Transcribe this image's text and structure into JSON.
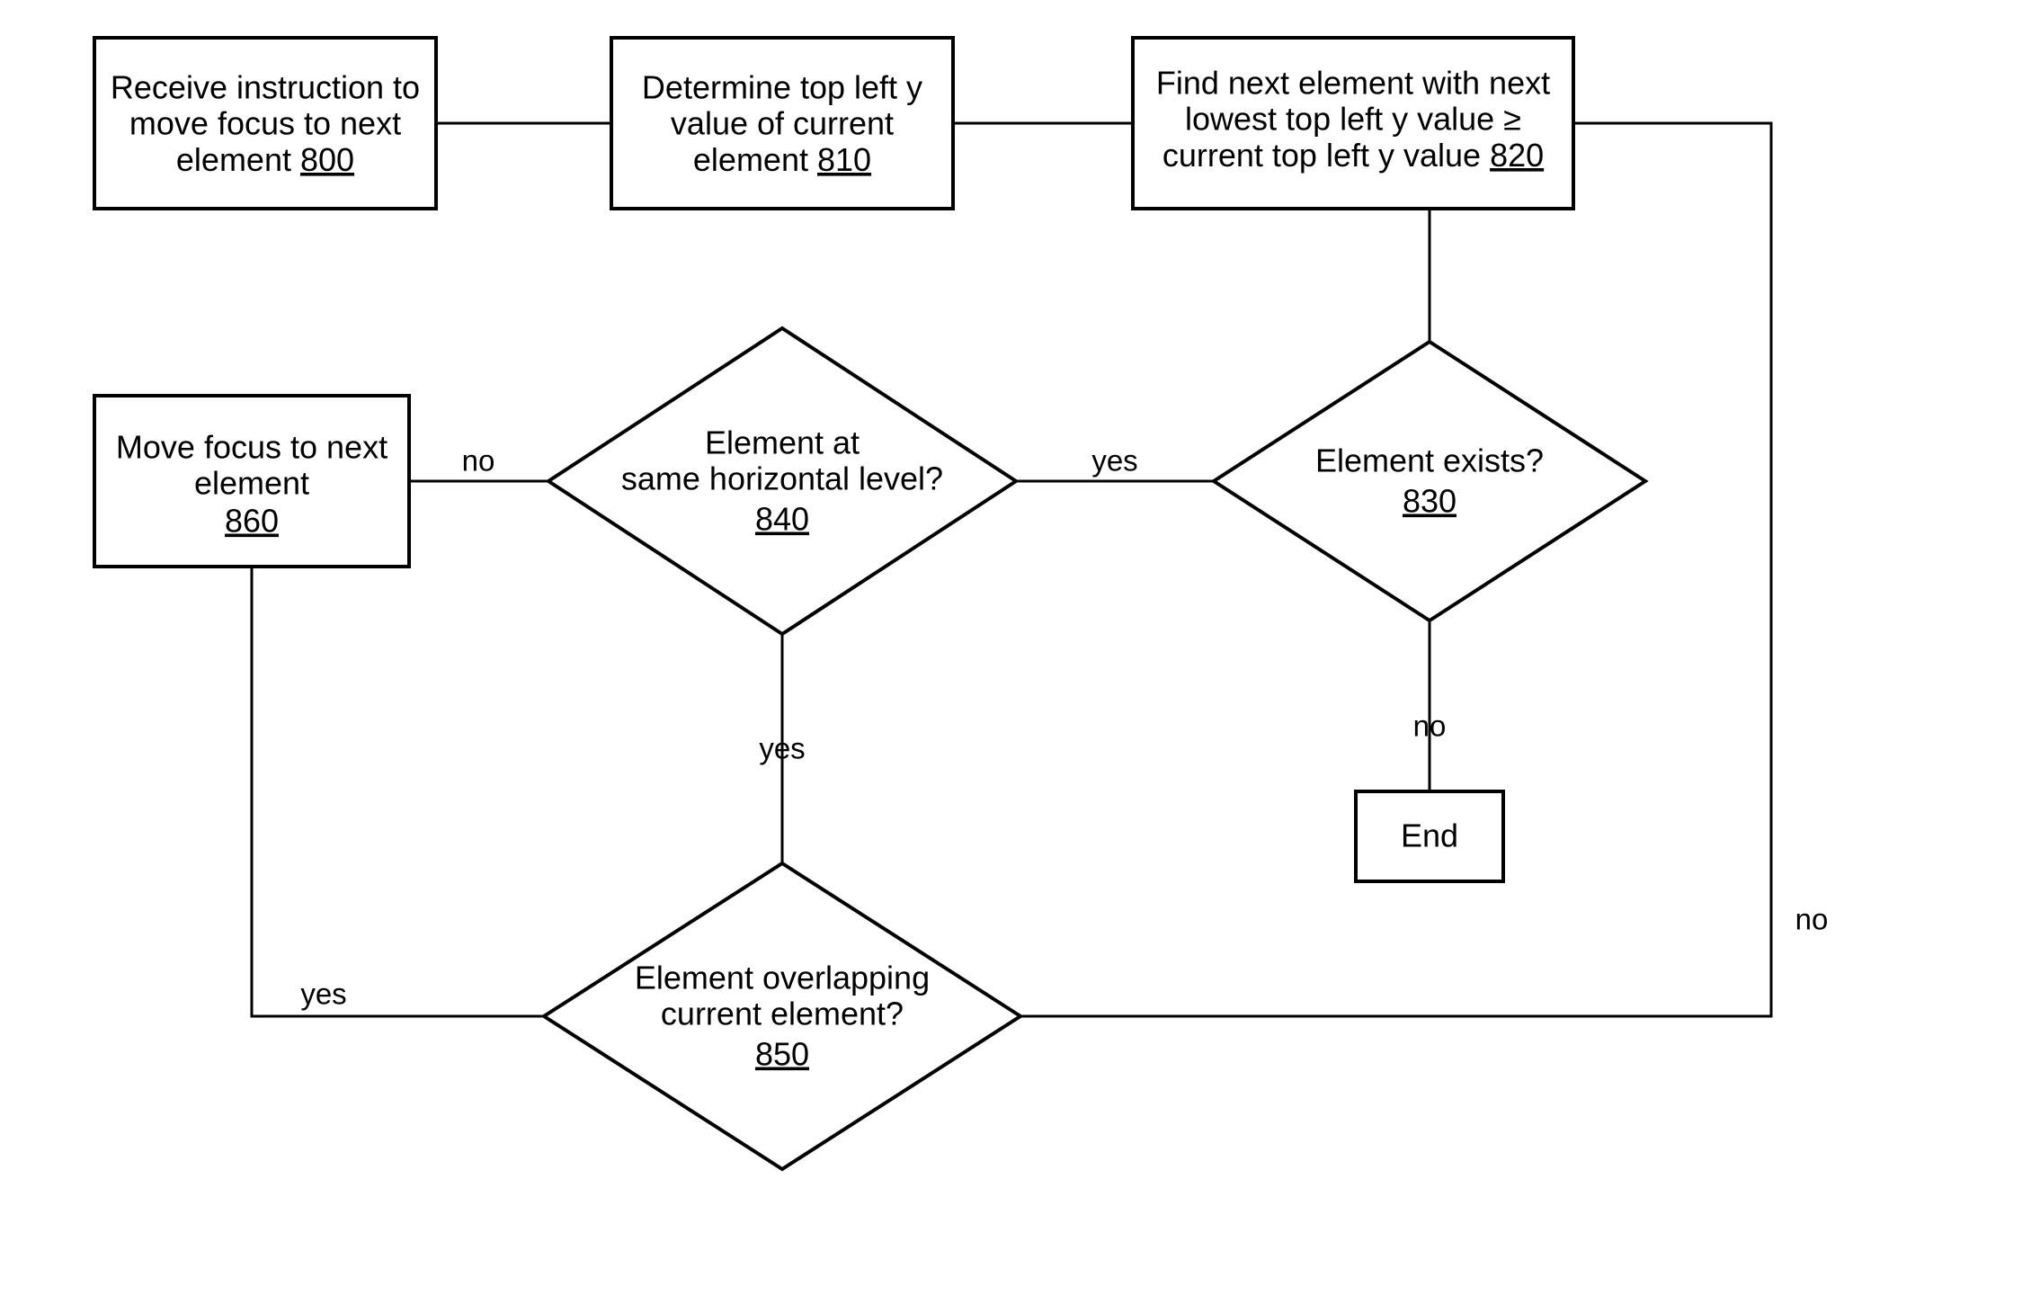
{
  "diagram": {
    "box800": {
      "l1": "Receive instruction to",
      "l2": "move focus to next",
      "l3": "element",
      "ref": "800"
    },
    "box810": {
      "l1": "Determine top left y",
      "l2": "value of current",
      "l3": "element",
      "ref": "810"
    },
    "box820": {
      "l1": "Find next element with next",
      "l2": "lowest top left y value ≥",
      "l3": "current top left y value",
      "ref": "820"
    },
    "box860": {
      "l1": "Move focus to next",
      "l2": "element",
      "ref": "860"
    },
    "d830": {
      "l1": "Element exists?",
      "ref": "830"
    },
    "d840": {
      "l1": "Element at",
      "l2": "same horizontal level?",
      "ref": "840"
    },
    "d850": {
      "l1": "Element overlapping",
      "l2": "current element?",
      "ref": "850"
    },
    "end": {
      "l1": "End"
    },
    "labels": {
      "yes": "yes",
      "no": "no"
    }
  }
}
